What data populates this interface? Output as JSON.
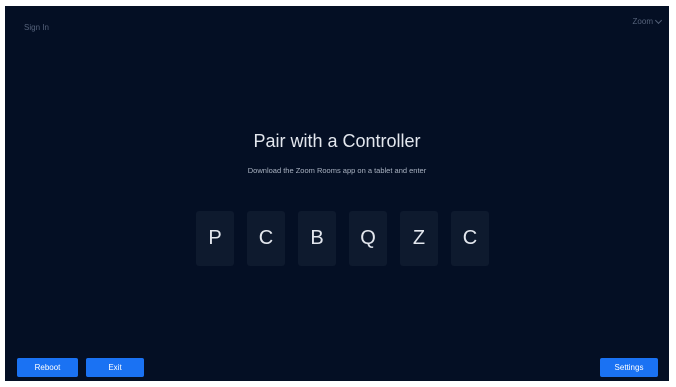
{
  "header": {
    "sign_in": "Sign In",
    "brand_menu": "Zoom"
  },
  "main": {
    "title": "Pair with a Controller",
    "subtitle": "Download the Zoom Rooms app on a tablet and enter",
    "code": [
      "P",
      "C",
      "B",
      "Q",
      "Z",
      "C"
    ]
  },
  "footer": {
    "reboot_label": "Reboot",
    "exit_label": "Exit",
    "settings_label": "Settings"
  },
  "colors": {
    "background": "#040f24",
    "accent": "#1a72f3",
    "code_tile": "#0e1a2e"
  }
}
